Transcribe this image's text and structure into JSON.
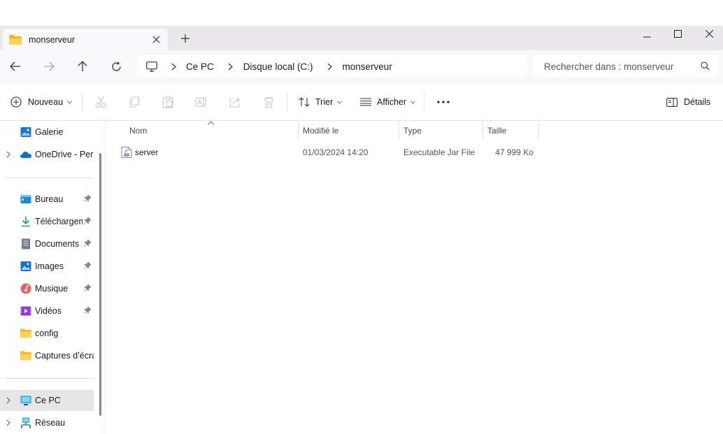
{
  "tab": {
    "title": "monserveur"
  },
  "breadcrumb": [
    {
      "label": "Ce PC"
    },
    {
      "label": "Disque local (C:)"
    },
    {
      "label": "monserveur"
    }
  ],
  "search": {
    "placeholder": "Rechercher dans : monserveur"
  },
  "toolbar": {
    "new_label": "Nouveau",
    "sort_label": "Trier",
    "view_label": "Afficher",
    "details_label": "Détails"
  },
  "sidebar": {
    "items": [
      {
        "label": "Galerie",
        "icon": "gallery-icon"
      },
      {
        "label": "OneDrive - Perso",
        "icon": "onedrive-icon"
      },
      {
        "label": "Bureau",
        "icon": "desktop-icon",
        "pinned": true
      },
      {
        "label": "Téléchargements",
        "icon": "download-icon",
        "pinned": true
      },
      {
        "label": "Documents",
        "icon": "documents-icon",
        "pinned": true
      },
      {
        "label": "Images",
        "icon": "images-icon",
        "pinned": true
      },
      {
        "label": "Musique",
        "icon": "music-icon",
        "pinned": true
      },
      {
        "label": "Vidéos",
        "icon": "videos-icon",
        "pinned": true
      },
      {
        "label": "config",
        "icon": "folder-icon"
      },
      {
        "label": "Captures d’écran",
        "icon": "folder-icon"
      },
      {
        "label": "Ce PC",
        "icon": "this-pc-icon",
        "selected": true
      },
      {
        "label": "Réseau",
        "icon": "network-icon"
      }
    ]
  },
  "columns": {
    "name": "Nom",
    "modified": "Modifié le",
    "type": "Type",
    "size": "Taille"
  },
  "files": [
    {
      "name": "server",
      "modified": "01/03/2024 14:20",
      "type": "Executable Jar File",
      "size": "47 999 Ko",
      "icon": "jar-file-icon"
    }
  ],
  "colors": {
    "accent": "#0067c0",
    "folder": "#f7c948",
    "titlebar": "#ebe8ec"
  }
}
